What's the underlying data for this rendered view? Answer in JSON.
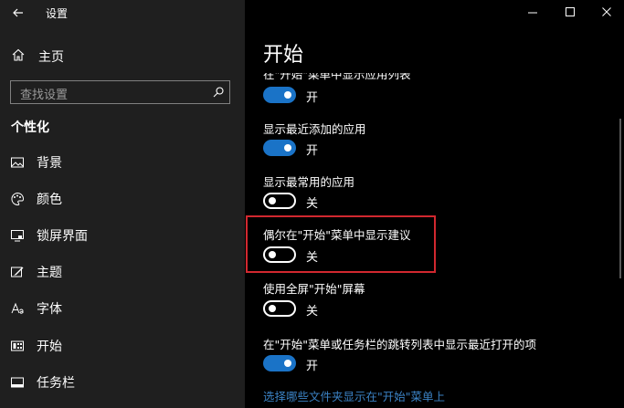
{
  "window": {
    "title": "设置"
  },
  "sidebar": {
    "home_label": "主页",
    "search_placeholder": "查找设置",
    "section_title": "个性化",
    "items": [
      {
        "label": "背景",
        "icon": "picture-icon"
      },
      {
        "label": "颜色",
        "icon": "palette-icon"
      },
      {
        "label": "锁屏界面",
        "icon": "lock-screen-icon"
      },
      {
        "label": "主题",
        "icon": "theme-brush-icon"
      },
      {
        "label": "字体",
        "icon": "font-icon"
      },
      {
        "label": "开始",
        "icon": "start-menu-icon"
      },
      {
        "label": "任务栏",
        "icon": "taskbar-icon"
      }
    ]
  },
  "main": {
    "title": "开始",
    "settings": [
      {
        "label": "在\"开始\"菜单中显示应用列表",
        "state": "开",
        "on": true
      },
      {
        "label": "显示最近添加的应用",
        "state": "开",
        "on": true
      },
      {
        "label": "显示最常用的应用",
        "state": "关",
        "on": false
      },
      {
        "label": "偶尔在\"开始\"菜单中显示建议",
        "state": "关",
        "on": false
      },
      {
        "label": "使用全屏\"开始\"屏幕",
        "state": "关",
        "on": false
      },
      {
        "label": "在\"开始\"菜单或任务栏的跳转列表中显示最近打开的项",
        "state": "开",
        "on": true
      }
    ],
    "link": "选择哪些文件夹显示在\"开始\"菜单上"
  },
  "colors": {
    "accent": "#1a73c7",
    "highlight": "#d1282f",
    "link": "#3b82c4"
  }
}
